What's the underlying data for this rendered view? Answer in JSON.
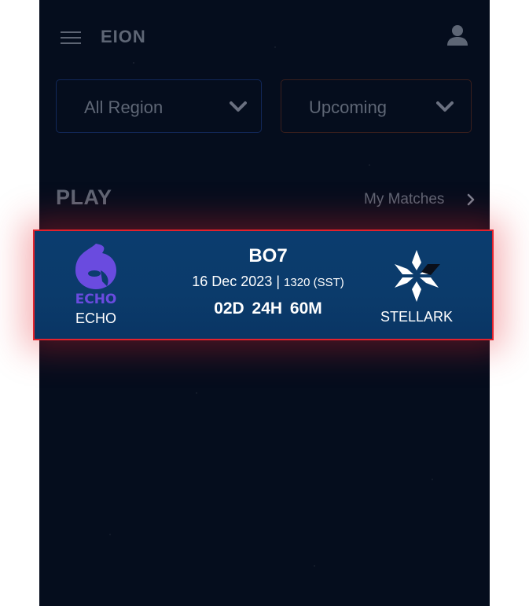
{
  "app": {
    "logo_text": "EION"
  },
  "header": {
    "menu_icon": "hamburger-menu-icon",
    "profile_icon": "user-icon"
  },
  "filters": {
    "region": {
      "selected": "All Region"
    },
    "status": {
      "selected": "Upcoming"
    }
  },
  "section": {
    "title": "PLAY",
    "link_label": "My Matches"
  },
  "match": {
    "format": "BO7",
    "date": "16 Dec 2023",
    "separator": "|",
    "time": "1320 (SST)",
    "countdown": "02D 24H 60M",
    "team_left": {
      "name": "ECHO",
      "logo_text": "ECHO",
      "logo_color": "#6a4bdf"
    },
    "team_right": {
      "name": "STELLARK"
    }
  },
  "colors": {
    "background": "#050d1d",
    "card": "#0b3c6e",
    "highlight_border": "#e3222c",
    "muted_text": "#5e6675"
  }
}
